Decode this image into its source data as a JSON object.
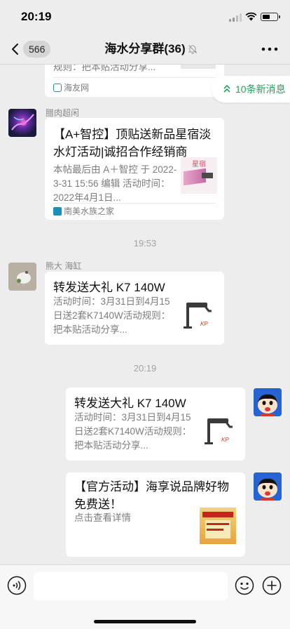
{
  "status": {
    "time": "20:19"
  },
  "nav": {
    "back_count": "566",
    "title": "海水分享群(36)"
  },
  "new_messages": "10条新消息",
  "messages": [
    {
      "kind": "card-partial",
      "desc_line": "规则：把本贴活动分享...",
      "source": "海友网"
    },
    {
      "kind": "card",
      "sender": "腊肉超闲",
      "title": "【A+智控】顶贴送新品星宿淡水灯活动|诚招合作经销商",
      "desc": "本帖最后由 A＋智控 于 2022-3-31 15:56 编辑 活动时间：2022年4月1日...",
      "thumb_text": "星宿",
      "source": "南美水族之家"
    },
    {
      "kind": "time",
      "text": "19:53"
    },
    {
      "kind": "card",
      "sender": "熊大 海缸",
      "title": "转发送大礼 K7 140W",
      "desc": "活动时间：3月31日到4月15日送2套K7140W活动规则：把本贴活动分享..."
    },
    {
      "kind": "time",
      "text": "20:19"
    },
    {
      "kind": "card-self",
      "title": "转发送大礼 K7 140W",
      "desc": "活动时间：3月31日到4月15日送2套K7140W活动规则：把本贴活动分享..."
    },
    {
      "kind": "card-self",
      "title": "【官方活动】海享说品牌好物免费送！",
      "desc": "点击查看详情"
    }
  ],
  "input": {
    "value": "",
    "placeholder": ""
  },
  "colors": {
    "accent": "#23a25a",
    "background": "#ededed",
    "bubble": "#ffffff"
  },
  "icons": [
    "back-arrow-icon",
    "mute-icon",
    "more-icon",
    "voice-icon",
    "emoji-icon",
    "plus-icon"
  ]
}
